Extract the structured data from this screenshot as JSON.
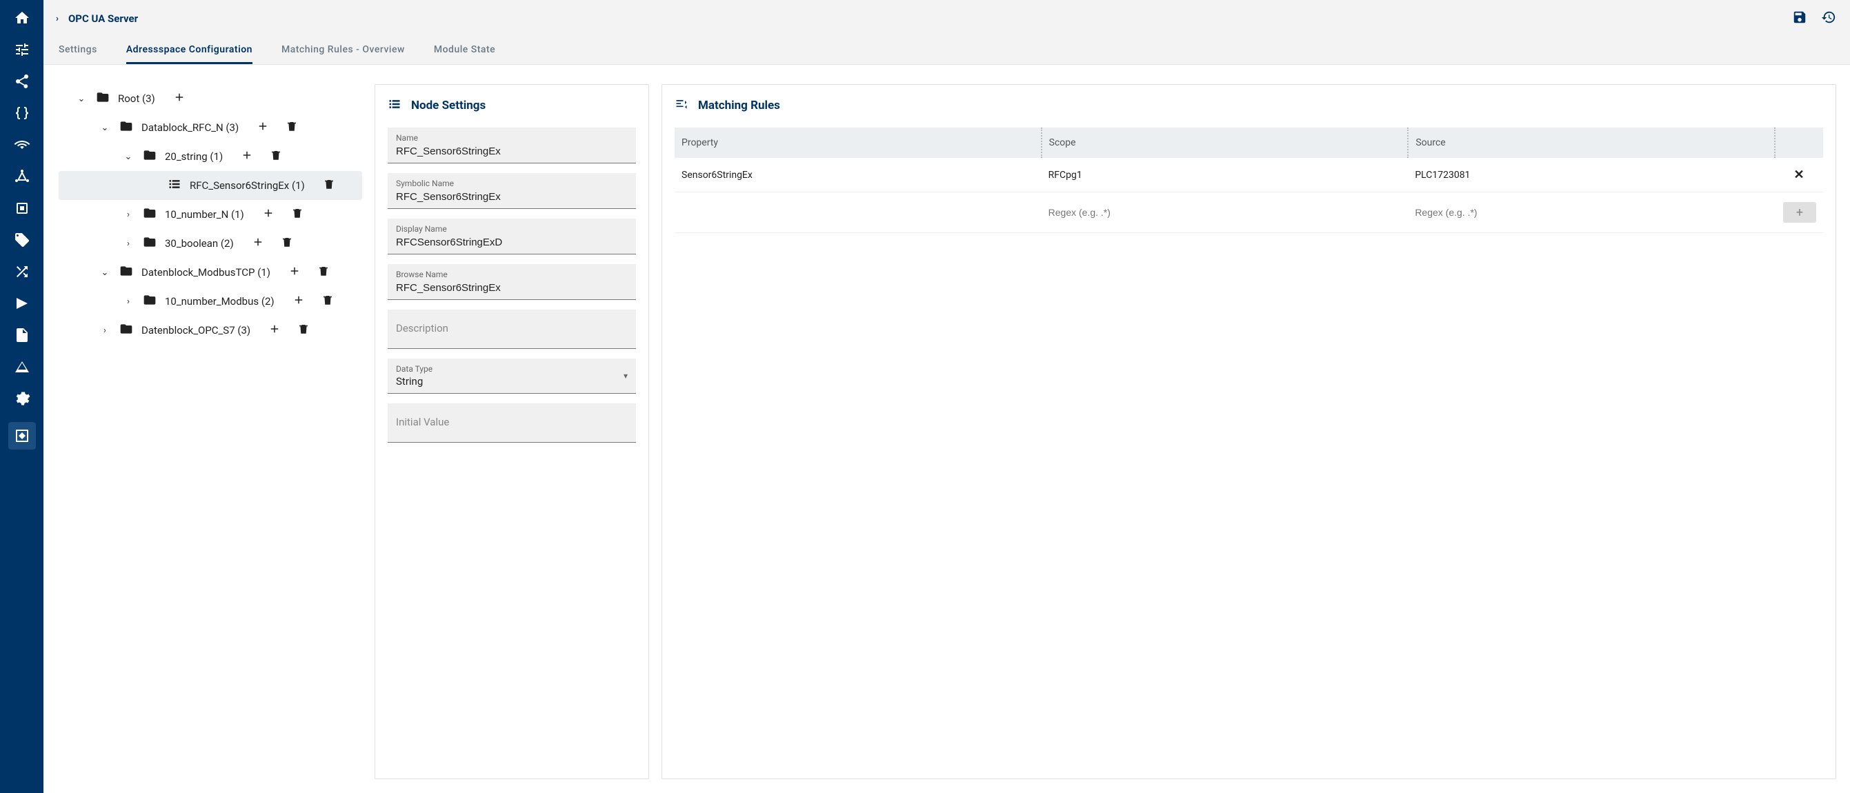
{
  "breadcrumb": {
    "title": "OPC UA Server"
  },
  "tabs": {
    "settings": "Settings",
    "addressspace": "Adressspace Configuration",
    "matching": "Matching Rules - Overview",
    "module": "Module State"
  },
  "tree": {
    "root": "Root (3)",
    "datablock_rfc_n": "Datablock_RFC_N (3)",
    "string_20": "20_string (1)",
    "rfc_sensor6": "RFC_Sensor6StringEx (1)",
    "number_10_n": "10_number_N (1)",
    "boolean_30": "30_boolean (2)",
    "datablock_modbus": "Datenblock_ModbusTCP (1)",
    "number_10_modbus": "10_number_Modbus (2)",
    "datablock_opc_s7": "Datenblock_OPC_S7 (3)"
  },
  "node_settings": {
    "title": "Node Settings",
    "name_label": "Name",
    "name_value": "RFC_Sensor6StringEx",
    "symbolic_label": "Symbolic Name",
    "symbolic_value": "RFC_Sensor6StringEx",
    "display_label": "Display Name",
    "display_value": "RFCSensor6StringExD",
    "browse_label": "Browse Name",
    "browse_value": "RFC_Sensor6StringEx",
    "description_label": "Description",
    "datatype_label": "Data Type",
    "datatype_value": "String",
    "initial_label": "Initial Value"
  },
  "matching_rules": {
    "title": "Matching Rules",
    "columns": {
      "property": "Property",
      "scope": "Scope",
      "source": "Source"
    },
    "rows": [
      {
        "property": "Sensor6StringEx",
        "scope": "RFCpg1",
        "source": "PLC1723081"
      }
    ],
    "regex_placeholder": "Regex (e.g. .*)"
  }
}
